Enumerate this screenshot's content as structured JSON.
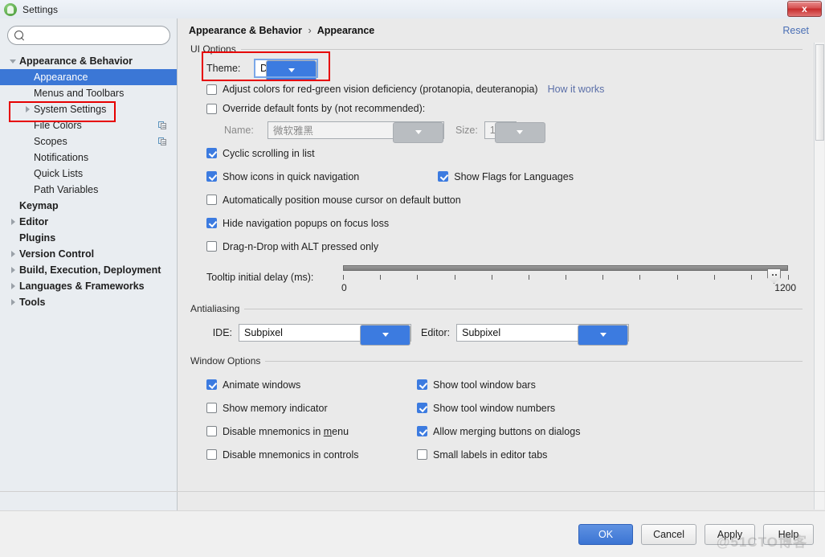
{
  "window": {
    "title": "Settings",
    "app_icon": "android-studio-icon",
    "close_label": "x"
  },
  "sidebar": {
    "search": {
      "value": "",
      "placeholder": "",
      "icon": "search-icon"
    },
    "items": [
      {
        "label": "Appearance & Behavior",
        "bold": true,
        "indent": 0,
        "twisty": "down",
        "selected": false,
        "badge": ""
      },
      {
        "label": "Appearance",
        "bold": false,
        "indent": 1,
        "twisty": "none",
        "selected": true,
        "badge": ""
      },
      {
        "label": "Menus and Toolbars",
        "bold": false,
        "indent": 1,
        "twisty": "none",
        "selected": false,
        "badge": ""
      },
      {
        "label": "System Settings",
        "bold": false,
        "indent": 1,
        "twisty": "right",
        "selected": false,
        "badge": ""
      },
      {
        "label": "File Colors",
        "bold": false,
        "indent": 1,
        "twisty": "none",
        "selected": false,
        "badge": "copy-icon"
      },
      {
        "label": "Scopes",
        "bold": false,
        "indent": 1,
        "twisty": "none",
        "selected": false,
        "badge": "copy-icon"
      },
      {
        "label": "Notifications",
        "bold": false,
        "indent": 1,
        "twisty": "none",
        "selected": false,
        "badge": ""
      },
      {
        "label": "Quick Lists",
        "bold": false,
        "indent": 1,
        "twisty": "none",
        "selected": false,
        "badge": ""
      },
      {
        "label": "Path Variables",
        "bold": false,
        "indent": 1,
        "twisty": "none",
        "selected": false,
        "badge": ""
      },
      {
        "label": "Keymap",
        "bold": true,
        "indent": 0,
        "twisty": "none",
        "selected": false,
        "badge": ""
      },
      {
        "label": "Editor",
        "bold": true,
        "indent": 0,
        "twisty": "right",
        "selected": false,
        "badge": ""
      },
      {
        "label": "Plugins",
        "bold": true,
        "indent": 0,
        "twisty": "none",
        "selected": false,
        "badge": ""
      },
      {
        "label": "Version Control",
        "bold": true,
        "indent": 0,
        "twisty": "right",
        "selected": false,
        "badge": ""
      },
      {
        "label": "Build, Execution, Deployment",
        "bold": true,
        "indent": 0,
        "twisty": "right",
        "selected": false,
        "badge": ""
      },
      {
        "label": "Languages & Frameworks",
        "bold": true,
        "indent": 0,
        "twisty": "right",
        "selected": false,
        "badge": ""
      },
      {
        "label": "Tools",
        "bold": true,
        "indent": 0,
        "twisty": "right",
        "selected": false,
        "badge": ""
      }
    ]
  },
  "header": {
    "crumb_root": "Appearance & Behavior",
    "crumb_sep": "›",
    "crumb_leaf": "Appearance",
    "reset": "Reset"
  },
  "ui_options": {
    "title": "UI Options",
    "theme_label": "Theme:",
    "theme_value": "Darcula",
    "adjust_colors": {
      "label": "Adjust colors for red-green vision deficiency (protanopia, deuteranopia)",
      "checked": false
    },
    "how_it_works": "How it works",
    "override_fonts": {
      "label": "Override default fonts by (not recommended):",
      "checked": false
    },
    "name_label": "Name:",
    "name_value": "微软雅黑",
    "size_label": "Size:",
    "size_value": "12",
    "cyclic_scrolling": {
      "label": "Cyclic scrolling in list",
      "checked": true
    },
    "show_icons_quick_nav": {
      "label": "Show icons in quick navigation",
      "checked": true
    },
    "show_flags_languages": {
      "label": "Show Flags for Languages",
      "checked": true
    },
    "auto_position_cursor": {
      "label": "Automatically position mouse cursor on default button",
      "checked": false
    },
    "hide_nav_popups": {
      "label": "Hide navigation popups on focus loss",
      "checked": true
    },
    "drag_n_drop_alt": {
      "label": "Drag-n-Drop with ALT pressed only",
      "checked": false
    },
    "tooltip_label": "Tooltip initial delay (ms):",
    "tooltip_min": "0",
    "tooltip_max": "1200",
    "tooltip_value": 1200
  },
  "antialiasing": {
    "title": "Antialiasing",
    "ide_label": "IDE:",
    "ide_value": "Subpixel",
    "editor_label": "Editor:",
    "editor_value": "Subpixel"
  },
  "window_options": {
    "title": "Window Options",
    "rows": [
      {
        "left": {
          "label": "Animate windows",
          "checked": true
        },
        "right": {
          "label": "Show tool window bars",
          "checked": true
        }
      },
      {
        "left": {
          "label": "Show memory indicator",
          "checked": false
        },
        "right": {
          "label": "Show tool window numbers",
          "checked": true
        }
      },
      {
        "left": {
          "label": "Disable mnemonics in menu",
          "mnemonic": "m",
          "checked": false
        },
        "right": {
          "label": "Allow merging buttons on dialogs",
          "checked": true
        }
      },
      {
        "left": {
          "label": "Disable mnemonics in controls",
          "checked": false
        },
        "right": {
          "label": "Small labels in editor tabs",
          "checked": false
        }
      }
    ]
  },
  "footer": {
    "ok": "OK",
    "cancel": "Cancel",
    "apply": "Apply",
    "help": "Help"
  },
  "watermark": "@51CTO博客",
  "colors": {
    "selection_blue": "#3b77d6",
    "accent_blue": "#3c7be0",
    "annotation_red": "#e60000",
    "link_blue": "#5b6fa8"
  }
}
